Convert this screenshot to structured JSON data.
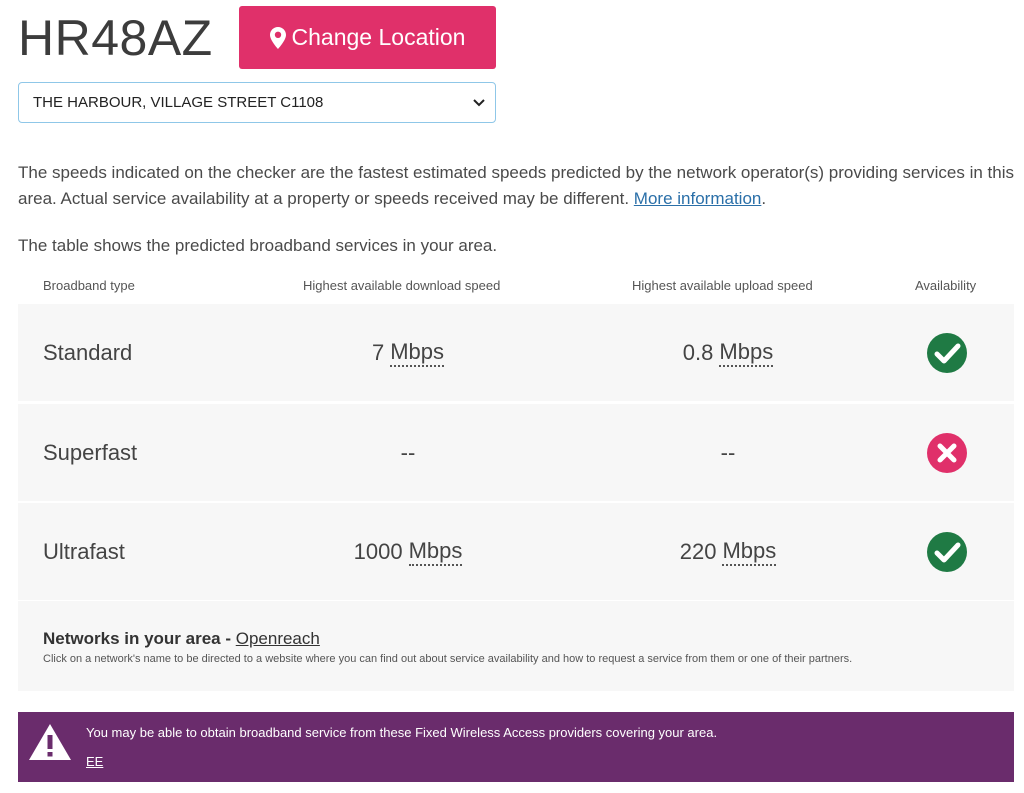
{
  "header": {
    "postcode": "HR48AZ",
    "change_location_label": "Change Location"
  },
  "address_select": {
    "selected": "THE HARBOUR, VILLAGE STREET C1108"
  },
  "info": {
    "text": "The speeds indicated on the checker are the fastest estimated speeds predicted by the network operator(s) providing services in this area. Actual service availability at a property or speeds received may be different.",
    "link_label": "More information",
    "suffix": ".",
    "table_intro": "The table shows the predicted broadband services in your area."
  },
  "table": {
    "headers": {
      "type": "Broadband type",
      "download": "Highest available download speed",
      "upload": "Highest available upload speed",
      "availability": "Availability"
    },
    "rows": [
      {
        "type": "Standard",
        "download_value": "7",
        "download_unit": "Mbps",
        "upload_value": "0.8",
        "upload_unit": "Mbps",
        "available": true
      },
      {
        "type": "Superfast",
        "download_text": "--",
        "upload_text": "--",
        "available": false
      },
      {
        "type": "Ultrafast",
        "download_value": "1000",
        "download_unit": "Mbps",
        "upload_value": "220",
        "upload_unit": "Mbps",
        "available": true
      }
    ]
  },
  "networks": {
    "title": "Networks in your area",
    "separator": " - ",
    "link_label": "Openreach",
    "subtext": "Click on a network's name to be directed to a website where you can find out about service availability and how to request a service from them or one of their partners."
  },
  "fwa": {
    "message": "You may be able to obtain broadband service from these Fixed Wireless Access providers covering your area.",
    "link_label": "EE"
  },
  "colors": {
    "accent": "#e0306a",
    "available": "#1f7a44",
    "unavailable": "#e0306a",
    "banner": "#6a2c6c"
  }
}
